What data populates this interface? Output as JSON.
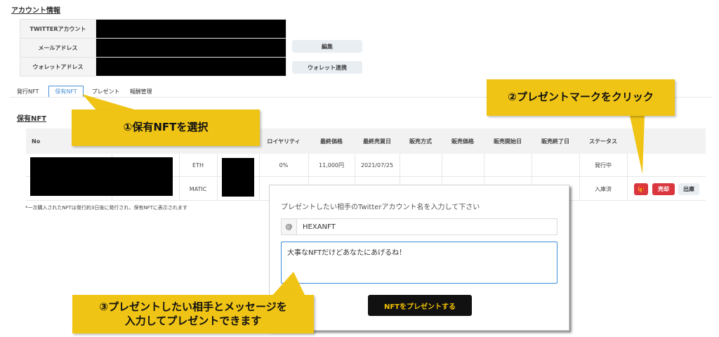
{
  "account": {
    "title": "アカウント情報",
    "fields": [
      {
        "label": "TWITTERアカウント"
      },
      {
        "label": "メールアドレス"
      },
      {
        "label": "ウォレットアドレス"
      }
    ],
    "edit_button": "編集",
    "wallet_button": "ウォレット連携"
  },
  "tabs": [
    {
      "label": "発行NFT",
      "active": false
    },
    {
      "label": "保有NFT",
      "active": true
    },
    {
      "label": "プレゼント",
      "active": false
    },
    {
      "label": "報酬管理",
      "active": false
    }
  ],
  "holdings": {
    "title": "保有NFT",
    "columns": [
      "No",
      "ロイヤリティ",
      "最終価格",
      "最終売買日",
      "販売方式",
      "販売価格",
      "販売開始日",
      "販売終了日",
      "ステータス"
    ],
    "rows": [
      {
        "chain": "ETH",
        "royalty": "0%",
        "last_price": "11,000円",
        "last_date": "2021/07/25",
        "status": "発行中"
      },
      {
        "chain": "MATIC",
        "status": "入庫済"
      }
    ],
    "gift_button": "🎁",
    "sell_button": "売却",
    "withdraw_button": "出庫",
    "note": "*一次購入されたNFTは発行約3日後に発行され、保有NFTに表示されます"
  },
  "modal": {
    "prompt": "プレゼントしたい相手のTwitterアカウント名を入力して下さい",
    "at_symbol": "@",
    "twitter_value": "HEXANFT",
    "message_value": "大事なNFTだけどあなたにあげるね！",
    "submit_label": "NFTをプレゼントする"
  },
  "annotations": {
    "step1": "①保有NFTを選択",
    "step2": "②プレゼントマークをクリック",
    "step3_line1": "③プレゼントしたい相手とメッセージを",
    "step3_line2": "入力してプレゼントできます"
  },
  "colors": {
    "callout": "#f0c415",
    "accent_blue": "#4a90d9",
    "danger_red": "#d9363e"
  }
}
